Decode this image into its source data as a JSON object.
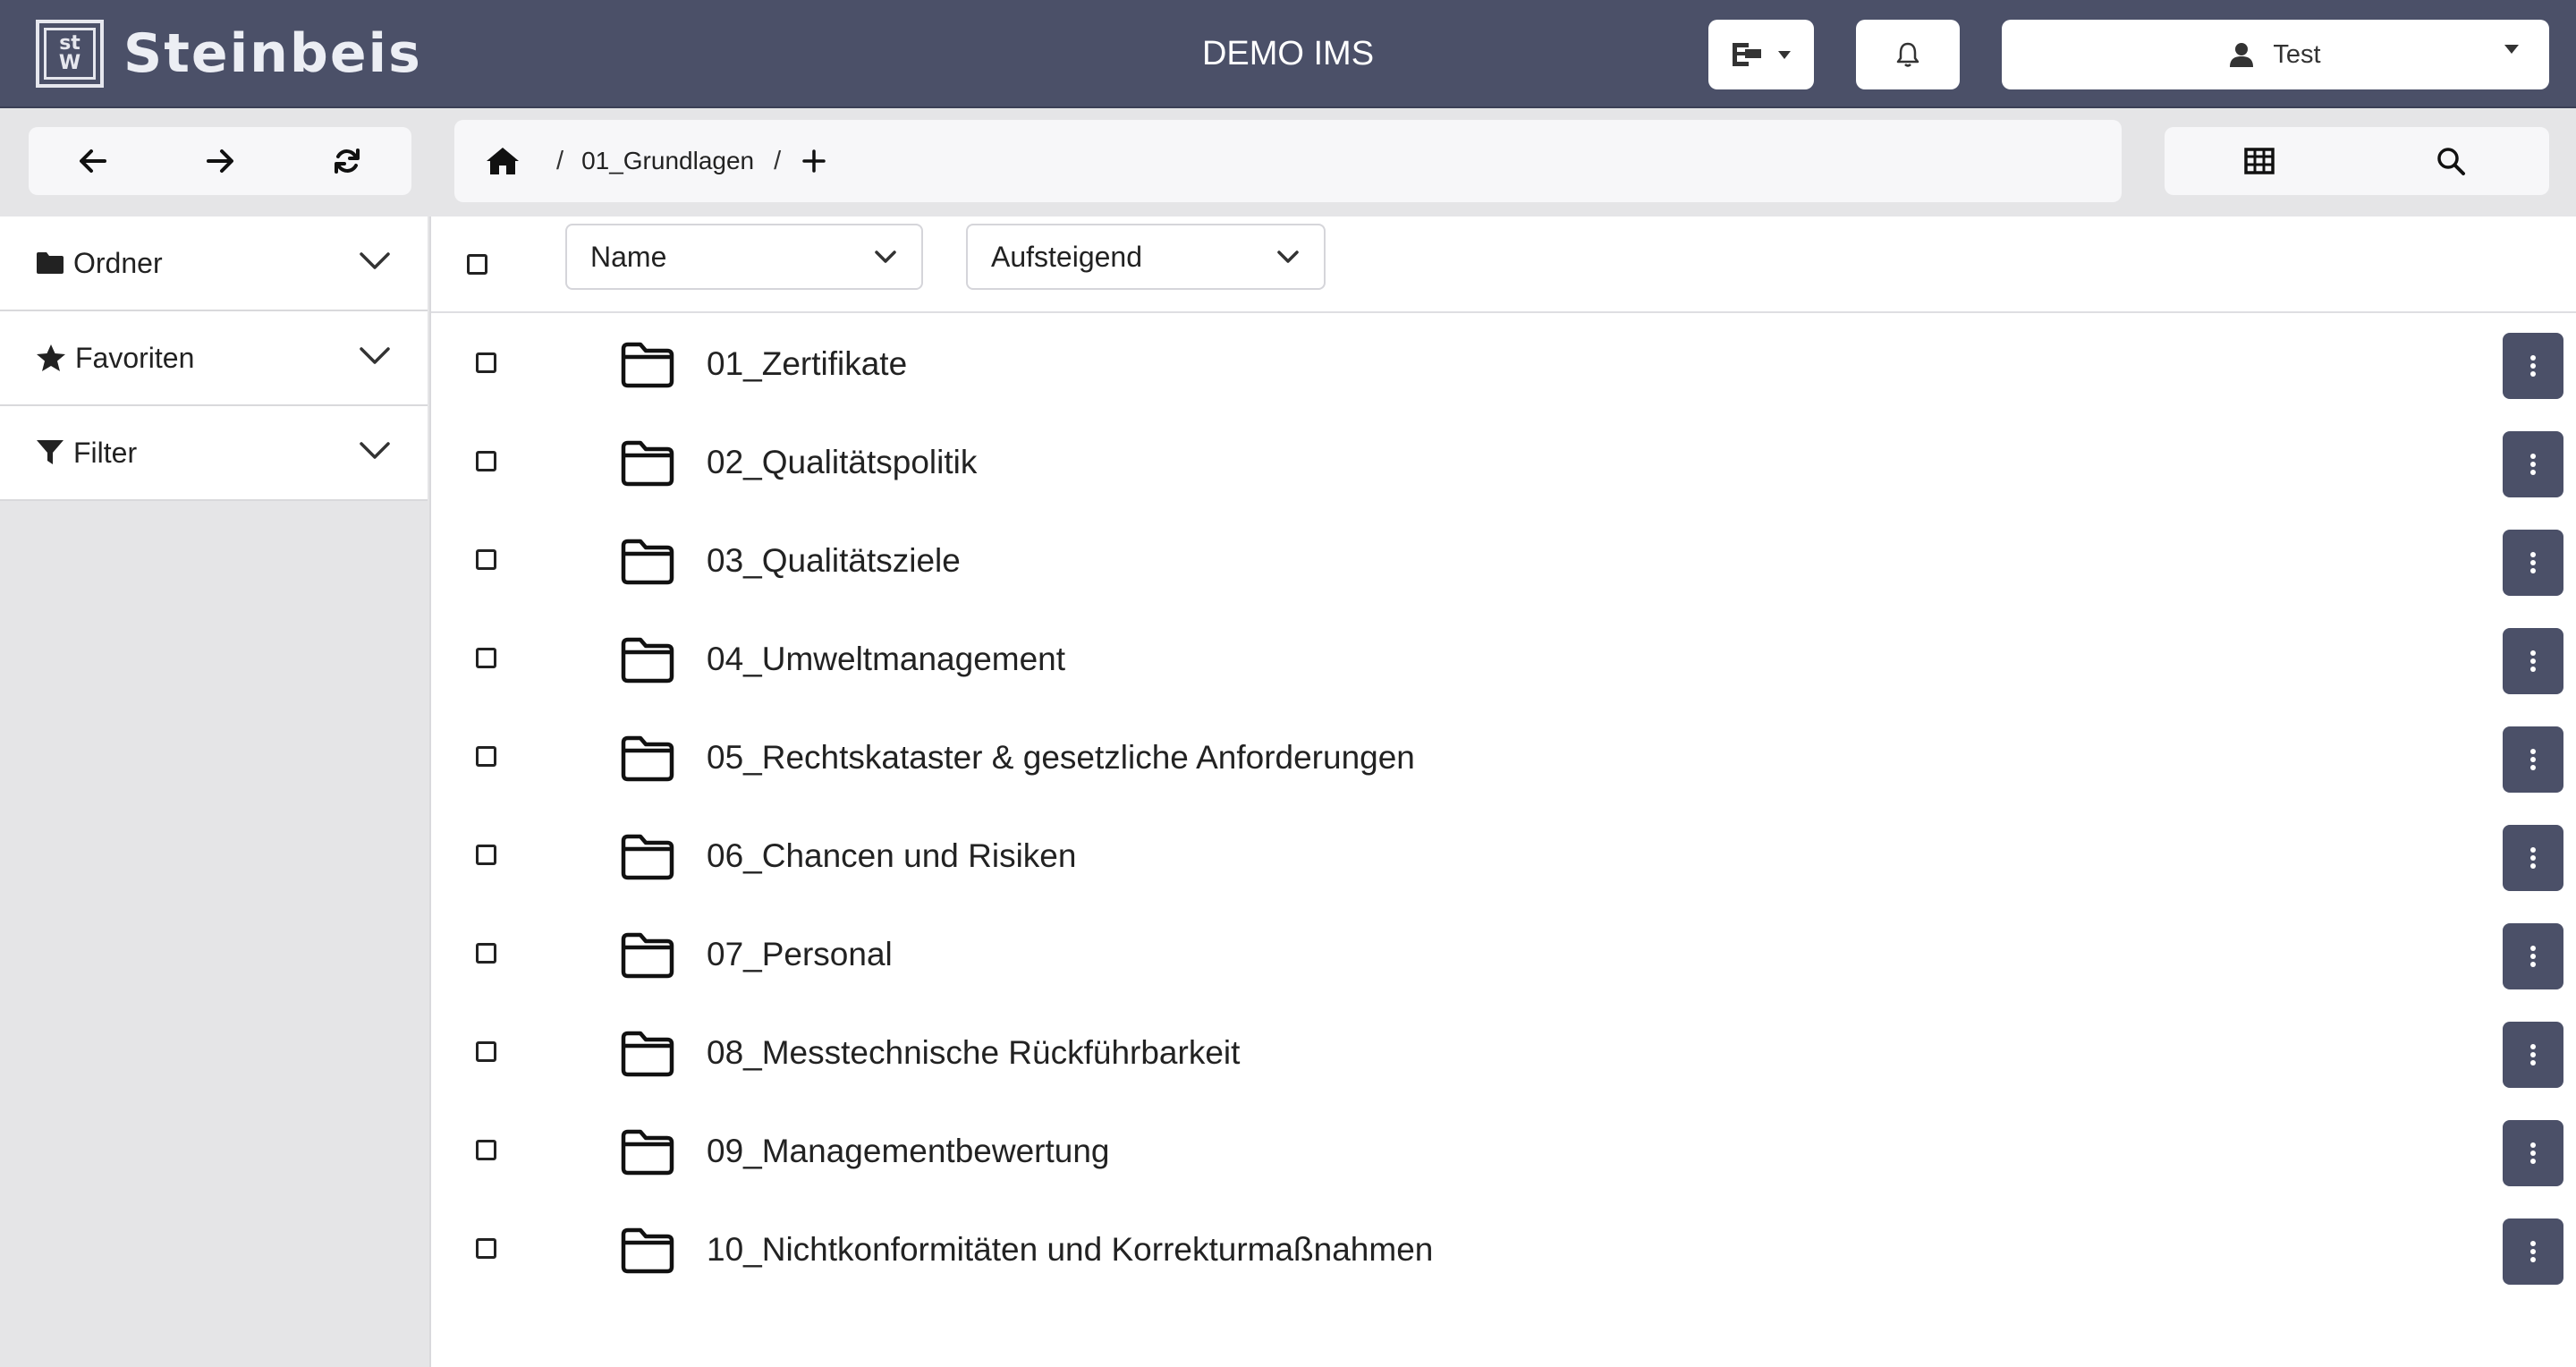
{
  "header": {
    "logo_small": [
      "st",
      "W"
    ],
    "brand": "Steinbeis",
    "app_title": "DEMO IMS",
    "user_name": "Test"
  },
  "breadcrumb": {
    "separator": "/",
    "items": [
      "01_Grundlagen"
    ]
  },
  "sidebar": {
    "items": [
      {
        "label": "Ordner",
        "icon": "folder-icon"
      },
      {
        "label": "Favoriten",
        "icon": "star-icon"
      },
      {
        "label": "Filter",
        "icon": "filter-icon"
      }
    ]
  },
  "sort": {
    "field": "Name",
    "order": "Aufsteigend"
  },
  "folders": [
    {
      "name": "01_Zertifikate"
    },
    {
      "name": "02_Qualitätspolitik"
    },
    {
      "name": "03_Qualitätsziele"
    },
    {
      "name": "04_Umweltmanagement"
    },
    {
      "name": "05_Rechtskataster & gesetzliche Anforderungen"
    },
    {
      "name": "06_Chancen und Risiken"
    },
    {
      "name": "07_Personal"
    },
    {
      "name": "08_Messtechnische Rückführbarkeit"
    },
    {
      "name": "09_Managementbewertung"
    },
    {
      "name": "10_Nichtkonformitäten und Korrekturmaßnahmen"
    }
  ],
  "colors": {
    "header_bg": "#4b5068",
    "accent_button": "#4b5068",
    "page_bg": "#e5e5e7"
  }
}
